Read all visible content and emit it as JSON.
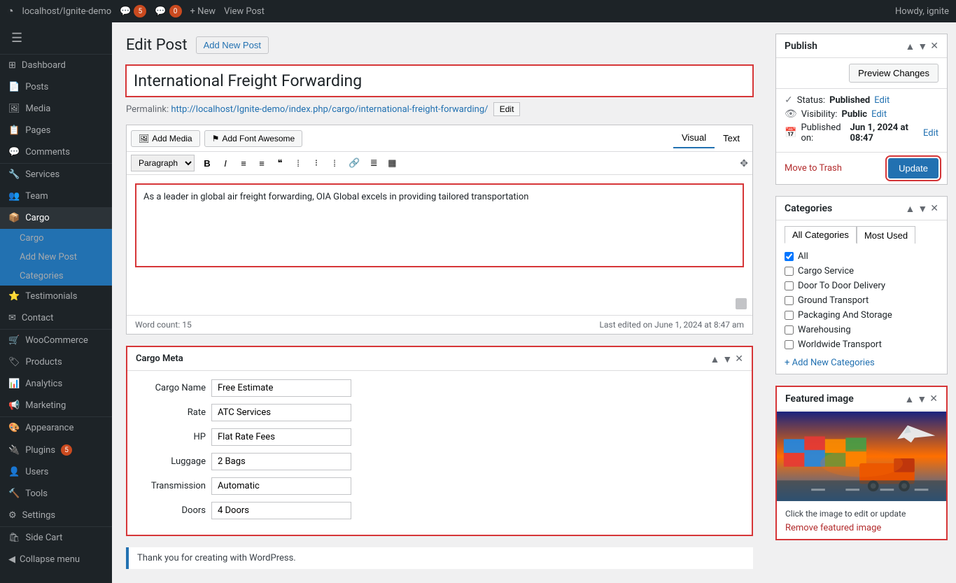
{
  "adminbar": {
    "wp_icon": "W",
    "site_name": "localhost/Ignite-demo",
    "comments_count": "5",
    "updates_count": "0",
    "new_label": "+ New",
    "view_post": "View Post",
    "howdy": "Howdy, ignite"
  },
  "sidebar": {
    "items": [
      {
        "id": "dashboard",
        "label": "Dashboard",
        "icon": "⊞"
      },
      {
        "id": "posts",
        "label": "Posts",
        "icon": "📄"
      },
      {
        "id": "media",
        "label": "Media",
        "icon": "🖼"
      },
      {
        "id": "pages",
        "label": "Pages",
        "icon": "📋"
      },
      {
        "id": "comments",
        "label": "Comments",
        "icon": "💬"
      },
      {
        "id": "services",
        "label": "Services",
        "icon": "🔧"
      },
      {
        "id": "team",
        "label": "Team",
        "icon": "👥"
      },
      {
        "id": "cargo",
        "label": "Cargo",
        "icon": "📦",
        "active": true
      },
      {
        "id": "testimonials",
        "label": "Testimonials",
        "icon": "⭐"
      },
      {
        "id": "contact",
        "label": "Contact",
        "icon": "✉"
      },
      {
        "id": "woocommerce",
        "label": "WooCommerce",
        "icon": "🛒"
      },
      {
        "id": "products",
        "label": "Products",
        "icon": "🏷"
      },
      {
        "id": "analytics",
        "label": "Analytics",
        "icon": "📊"
      },
      {
        "id": "marketing",
        "label": "Marketing",
        "icon": "📢"
      },
      {
        "id": "appearance",
        "label": "Appearance",
        "icon": "🎨"
      },
      {
        "id": "plugins",
        "label": "Plugins",
        "icon": "🔌",
        "badge": "5"
      },
      {
        "id": "users",
        "label": "Users",
        "icon": "👤"
      },
      {
        "id": "tools",
        "label": "Tools",
        "icon": "🔨"
      },
      {
        "id": "settings",
        "label": "Settings",
        "icon": "⚙"
      },
      {
        "id": "side-cart",
        "label": "Side Cart",
        "icon": "🛍"
      }
    ],
    "cargo_sub": [
      {
        "id": "cargo-main",
        "label": "Cargo"
      },
      {
        "id": "add-new-post",
        "label": "Add New Post"
      },
      {
        "id": "categories",
        "label": "Categories"
      }
    ],
    "collapse_label": "Collapse menu"
  },
  "header": {
    "page_title": "Edit Post",
    "add_new_label": "Add New Post"
  },
  "post": {
    "title": "International Freight Forwarding",
    "permalink_label": "Permalink:",
    "permalink_url": "http://localhost/Ignite-demo/index.php/cargo/international-freight-forwarding/",
    "permalink_edit": "Edit"
  },
  "editor": {
    "visual_tab": "Visual",
    "text_tab": "Text",
    "add_media": "Add Media",
    "add_font_awesome": "Add Font Awesome",
    "format_label": "Paragraph",
    "toolbar_buttons": [
      "B",
      "I",
      "≡",
      "≡",
      "❝",
      "≡",
      "≡",
      "≡",
      "🔗",
      "≡",
      "⊞"
    ],
    "content": "As a leader in global air freight forwarding, OIA Global excels in providing tailored transportation",
    "word_count_label": "Word count:",
    "word_count": "15",
    "last_edited": "Last edited on June 1, 2024 at 8:47 am"
  },
  "cargo_meta": {
    "title": "Cargo Meta",
    "fields": [
      {
        "id": "cargo-name",
        "label": "Cargo Name",
        "value": "Free Estimate"
      },
      {
        "id": "rate",
        "label": "Rate",
        "value": "ATC Services"
      },
      {
        "id": "hp",
        "label": "HP",
        "value": "Flat Rate Fees"
      },
      {
        "id": "luggage",
        "label": "Luggage",
        "value": "2 Bags"
      },
      {
        "id": "transmission",
        "label": "Transmission",
        "value": "Automatic"
      },
      {
        "id": "doors",
        "label": "Doors",
        "value": "4 Doors"
      }
    ]
  },
  "wp_notice": "Thank you for creating with WordPress.",
  "publish": {
    "title": "Publish",
    "preview_changes": "Preview Changes",
    "status_label": "Status:",
    "status_value": "Published",
    "status_edit": "Edit",
    "visibility_label": "Visibility:",
    "visibility_value": "Public",
    "visibility_edit": "Edit",
    "published_label": "Published on:",
    "published_value": "Jun 1, 2024 at 08:47",
    "published_edit": "Edit",
    "move_to_trash": "Move to Trash",
    "update_label": "Update"
  },
  "categories": {
    "title": "Categories",
    "tab_all": "All Categories",
    "tab_most_used": "Most Used",
    "items": [
      {
        "id": "all",
        "label": "All",
        "checked": true
      },
      {
        "id": "cargo-service",
        "label": "Cargo Service",
        "checked": false
      },
      {
        "id": "door-delivery",
        "label": "Door To Door Delivery",
        "checked": false
      },
      {
        "id": "ground-transport",
        "label": "Ground Transport",
        "checked": false
      },
      {
        "id": "packaging-storage",
        "label": "Packaging And Storage",
        "checked": false
      },
      {
        "id": "warehousing",
        "label": "Warehousing",
        "checked": false
      },
      {
        "id": "worldwide",
        "label": "Worldwide Transport",
        "checked": false
      }
    ],
    "add_link": "+ Add New Categories"
  },
  "featured_image": {
    "title": "Featured image",
    "note": "Click the image to edit or update",
    "remove_link": "Remove featured image"
  }
}
